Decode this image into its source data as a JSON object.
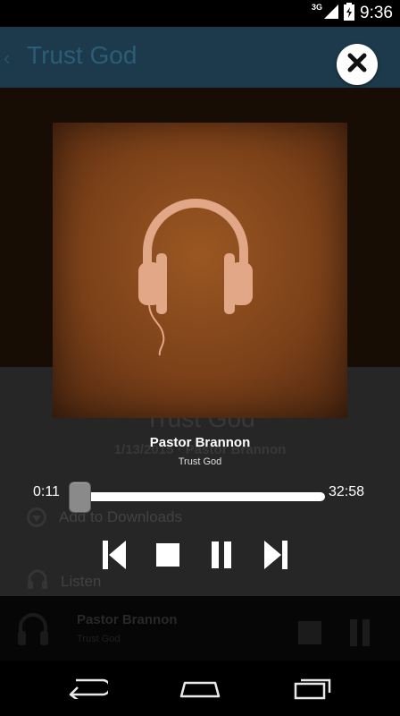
{
  "status_bar": {
    "network": "3G",
    "time": "9:36",
    "icons": [
      "signal-icon",
      "battery-icon"
    ]
  },
  "background_page": {
    "title": "Trust God",
    "sermon_title": "Trust God",
    "sermon_meta": "1/13/2015 · Pastor Brannon",
    "actions": [
      "Add to Downloads",
      "Listen"
    ],
    "now_playing": {
      "title": "Pastor Brannon",
      "subtitle": "Trust God"
    }
  },
  "player": {
    "artwork_icon": "headphones-icon",
    "title": "Pastor Brannon",
    "subtitle": "Trust God",
    "elapsed": "0:11",
    "duration": "32:58",
    "progress_fraction": 0.006,
    "controls": [
      "previous-icon",
      "stop-icon",
      "pause-icon",
      "next-icon"
    ],
    "close_icon": "close-icon"
  },
  "nav_bar": {
    "buttons": [
      "back-icon",
      "home-icon",
      "recent-apps-icon"
    ]
  },
  "colors": {
    "header_bg": "#1f3f52",
    "artwork_brown": "#8a4a1e",
    "headphones": "#e2a787"
  }
}
